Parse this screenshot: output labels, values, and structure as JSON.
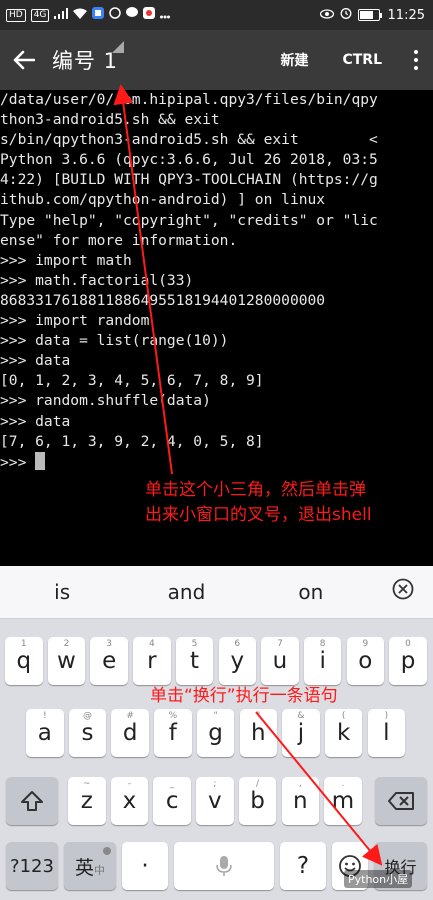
{
  "status_bar": {
    "badges": [
      "HD",
      "4G"
    ],
    "time": "11:25",
    "battery_level": 0.85
  },
  "toolbar": {
    "back_icon": "arrow-left-icon",
    "title": "编号 1",
    "new_label": "新建",
    "ctrl_label": "CTRL",
    "overflow_icon": "more-vertical-icon"
  },
  "terminal": {
    "lines": [
      "/data/user/0/com.hipipal.qpy3/files/bin/qpy",
      "thon3-android5.sh && exit",
      "s/bin/qpython3-android5.sh && exit        <",
      "Python 3.6.6 (qpyc:3.6.6, Jul 26 2018, 03:5",
      "4:22) [BUILD WITH QPY3-TOOLCHAIN (https://g",
      "ithub.com/qpython-android) ] on linux",
      "Type \"help\", \"copyright\", \"credits\" or \"lic",
      "ense\" for more information.",
      ">>> import math",
      ">>> math.factorial(33)",
      "8683317618811886495518194401280000000",
      ">>> import random",
      ">>> data = list(range(10))",
      ">>> data",
      "[0, 1, 2, 3, 4, 5, 6, 7, 8, 9]",
      ">>> random.shuffle(data)",
      ">>> data",
      "[7, 6, 1, 3, 9, 2, 4, 0, 5, 8]",
      ">>> "
    ]
  },
  "annotations": {
    "note1_line1": "单击这个小三角，然后单击弹",
    "note1_line2": "出来小窗口的叉号，退出shell",
    "note2": "单击“换行”执行一条语句",
    "color": "#ff1a1a"
  },
  "keyboard": {
    "suggestions": [
      "is",
      "and",
      "on"
    ],
    "suggestion_close_icon": "close-circle-icon",
    "row1": [
      {
        "key": "q",
        "hint": "1"
      },
      {
        "key": "w",
        "hint": "2"
      },
      {
        "key": "e",
        "hint": "3"
      },
      {
        "key": "r",
        "hint": "4"
      },
      {
        "key": "t",
        "hint": "5"
      },
      {
        "key": "y",
        "hint": "6"
      },
      {
        "key": "u",
        "hint": "7"
      },
      {
        "key": "i",
        "hint": "8"
      },
      {
        "key": "o",
        "hint": "9"
      },
      {
        "key": "p",
        "hint": "0"
      }
    ],
    "row2": [
      {
        "key": "a",
        "hint": "!"
      },
      {
        "key": "s",
        "hint": "@"
      },
      {
        "key": "d",
        "hint": "#"
      },
      {
        "key": "f",
        "hint": "%"
      },
      {
        "key": "g",
        "hint": "\""
      },
      {
        "key": "h",
        "hint": "\""
      },
      {
        "key": "j",
        "hint": "&"
      },
      {
        "key": "k",
        "hint": "("
      },
      {
        "key": "l",
        "hint": ")"
      }
    ],
    "row3": [
      {
        "key": "z",
        "hint": "~"
      },
      {
        "key": "x",
        "hint": "-"
      },
      {
        "key": "c",
        "hint": "_"
      },
      {
        "key": "v",
        "hint": ";"
      },
      {
        "key": "b",
        "hint": "/"
      },
      {
        "key": "n",
        "hint": ","
      },
      {
        "key": "m",
        "hint": "."
      }
    ],
    "shift_icon": "shift-arrow-icon",
    "backspace_icon": "backspace-icon",
    "sym_label": "?123",
    "ime_main": "英",
    "ime_sub": "中",
    "dot_label": "·",
    "mic_icon": "microphone-icon",
    "question_label": "?",
    "emoji_icon": "emoji-icon",
    "enter_label": "换行"
  },
  "watermark": "Python小屋"
}
